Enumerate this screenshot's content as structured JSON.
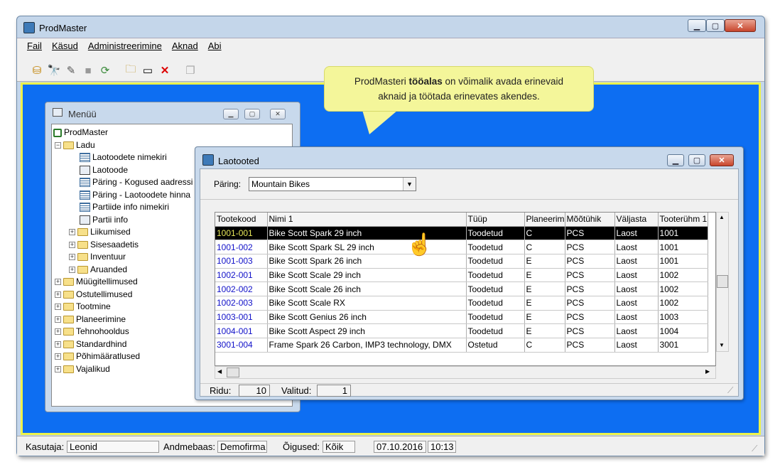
{
  "app": {
    "title": "ProdMaster"
  },
  "menubar": [
    "Fail",
    "Käsud",
    "Administreerimine",
    "Aknad",
    "Abi"
  ],
  "callout": {
    "pre": "ProdMasteri ",
    "bold": "tööalas",
    "post": " on võimalik avada erinevaid",
    "line2": "aknaid ja töötada erinevates akendes."
  },
  "menu_window": {
    "title": "Menüü",
    "tree": [
      {
        "label": "ProdMaster",
        "icon": "root-icon",
        "level": 0,
        "exp": ""
      },
      {
        "label": "Ladu",
        "icon": "folder-open-icon",
        "level": 1,
        "exp": "−"
      },
      {
        "label": "Laotoodete nimekiri",
        "icon": "list-icon",
        "level": 2,
        "exp": ""
      },
      {
        "label": "Laotoode",
        "icon": "form-icon",
        "level": 2,
        "exp": ""
      },
      {
        "label": "Päring - Kogused aadressi",
        "icon": "list-icon",
        "level": 2,
        "exp": ""
      },
      {
        "label": "Päring - Laotoodete hinna",
        "icon": "list-icon",
        "level": 2,
        "exp": ""
      },
      {
        "label": "Partiide info nimekiri",
        "icon": "list-icon",
        "level": 2,
        "exp": ""
      },
      {
        "label": "Partii info",
        "icon": "form-icon",
        "level": 2,
        "exp": ""
      },
      {
        "label": "Liikumised",
        "icon": "folder-icon",
        "level": 2,
        "exp": "+"
      },
      {
        "label": "Sisesaadetis",
        "icon": "folder-icon",
        "level": 2,
        "exp": "+"
      },
      {
        "label": "Inventuur",
        "icon": "folder-icon",
        "level": 2,
        "exp": "+"
      },
      {
        "label": "Aruanded",
        "icon": "folder-icon",
        "level": 2,
        "exp": "+"
      },
      {
        "label": "Müügitellimused",
        "icon": "folder-icon",
        "level": 1,
        "exp": "+"
      },
      {
        "label": "Ostutellimused",
        "icon": "folder-icon",
        "level": 1,
        "exp": "+"
      },
      {
        "label": "Tootmine",
        "icon": "folder-icon",
        "level": 1,
        "exp": "+"
      },
      {
        "label": "Planeerimine",
        "icon": "folder-icon",
        "level": 1,
        "exp": "+"
      },
      {
        "label": "Tehnohooldus",
        "icon": "folder-icon",
        "level": 1,
        "exp": "+"
      },
      {
        "label": "Standardhind",
        "icon": "folder-icon",
        "level": 1,
        "exp": "+"
      },
      {
        "label": "Põhimääratlused",
        "icon": "folder-icon",
        "level": 1,
        "exp": "+"
      },
      {
        "label": "Vajalikud",
        "icon": "folder-icon",
        "level": 1,
        "exp": "+"
      }
    ]
  },
  "laotooted": {
    "title": "Laotooted",
    "query_label": "Päring:",
    "query_value": "Mountain Bikes",
    "columns": [
      "Tootekood",
      "Nimi 1",
      "Tüüp",
      "Planeerim",
      "Mõõtühik",
      "Väljasta",
      "Tooterühm 1"
    ],
    "rows": [
      [
        "1001-001",
        "Bike Scott Spark 29 inch",
        "Toodetud",
        "C",
        "PCS",
        "Laost",
        "1001"
      ],
      [
        "1001-002",
        "Bike Scott Spark SL 29 inch",
        "Toodetud",
        "C",
        "PCS",
        "Laost",
        "1001"
      ],
      [
        "1001-003",
        "Bike Scott Spark 26 inch",
        "Toodetud",
        "E",
        "PCS",
        "Laost",
        "1001"
      ],
      [
        "1002-001",
        "Bike Scott Scale 29 inch",
        "Toodetud",
        "E",
        "PCS",
        "Laost",
        "1002"
      ],
      [
        "1002-002",
        "Bike Scott Scale 26 inch",
        "Toodetud",
        "E",
        "PCS",
        "Laost",
        "1002"
      ],
      [
        "1002-003",
        "Bike Scott Scale RX",
        "Toodetud",
        "E",
        "PCS",
        "Laost",
        "1002"
      ],
      [
        "1003-001",
        "Bike Scott Genius 26 inch",
        "Toodetud",
        "E",
        "PCS",
        "Laost",
        "1003"
      ],
      [
        "1004-001",
        "Bike Scott Aspect 29 inch",
        "Toodetud",
        "E",
        "PCS",
        "Laost",
        "1004"
      ],
      [
        "3001-004",
        "Frame Spark 26 Carbon, IMP3 technology, DMX",
        "Ostetud",
        "C",
        "PCS",
        "Laost",
        "3001"
      ]
    ],
    "selected_row": 0,
    "ridu_label": "Ridu:",
    "ridu_value": "10",
    "valitud_label": "Valitud:",
    "valitud_value": "1"
  },
  "status": {
    "user_label": "Kasutaja:",
    "user_value": "Leonid",
    "db_label": "Andmebaas:",
    "db_value": "Demofirma",
    "rights_label": "Õigused:",
    "rights_value": "Kõik",
    "date": "07.10.2016",
    "time": "10:13"
  },
  "colors": {
    "workspace": "#0d6ef2",
    "workspace_border": "#ecf24a",
    "callout": "#f4f69a",
    "selected_row": "#000000",
    "code_text": "#1010c8"
  }
}
